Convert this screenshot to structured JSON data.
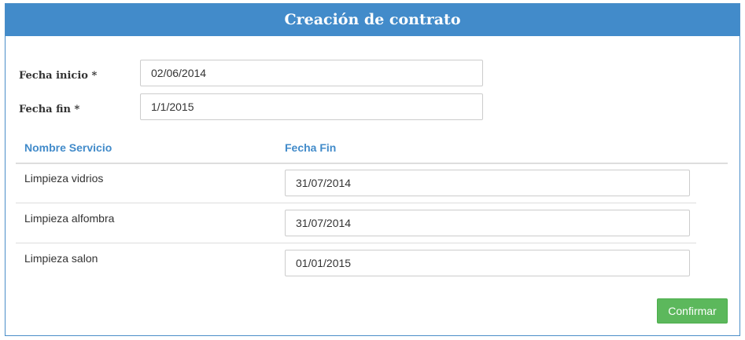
{
  "panel": {
    "title": "Creación de contrato"
  },
  "form": {
    "start_date": {
      "label": "Fecha inicio *",
      "value": "02/06/2014"
    },
    "end_date": {
      "label": "Fecha fin *",
      "value": "1/1/2015"
    }
  },
  "services_table": {
    "headers": [
      "Nombre Servicio",
      "Fecha Fin"
    ],
    "rows": [
      {
        "name": "Limpieza vidrios",
        "end_date": "31/07/2014"
      },
      {
        "name": "Limpieza alfombra",
        "end_date": "31/07/2014"
      },
      {
        "name": "Limpieza salon",
        "end_date": "01/01/2015"
      }
    ]
  },
  "actions": {
    "confirm_label": "Confirmar"
  },
  "colors": {
    "header_bg": "#428bca",
    "accent_text": "#428bca",
    "confirm_bg": "#5cb85c"
  }
}
